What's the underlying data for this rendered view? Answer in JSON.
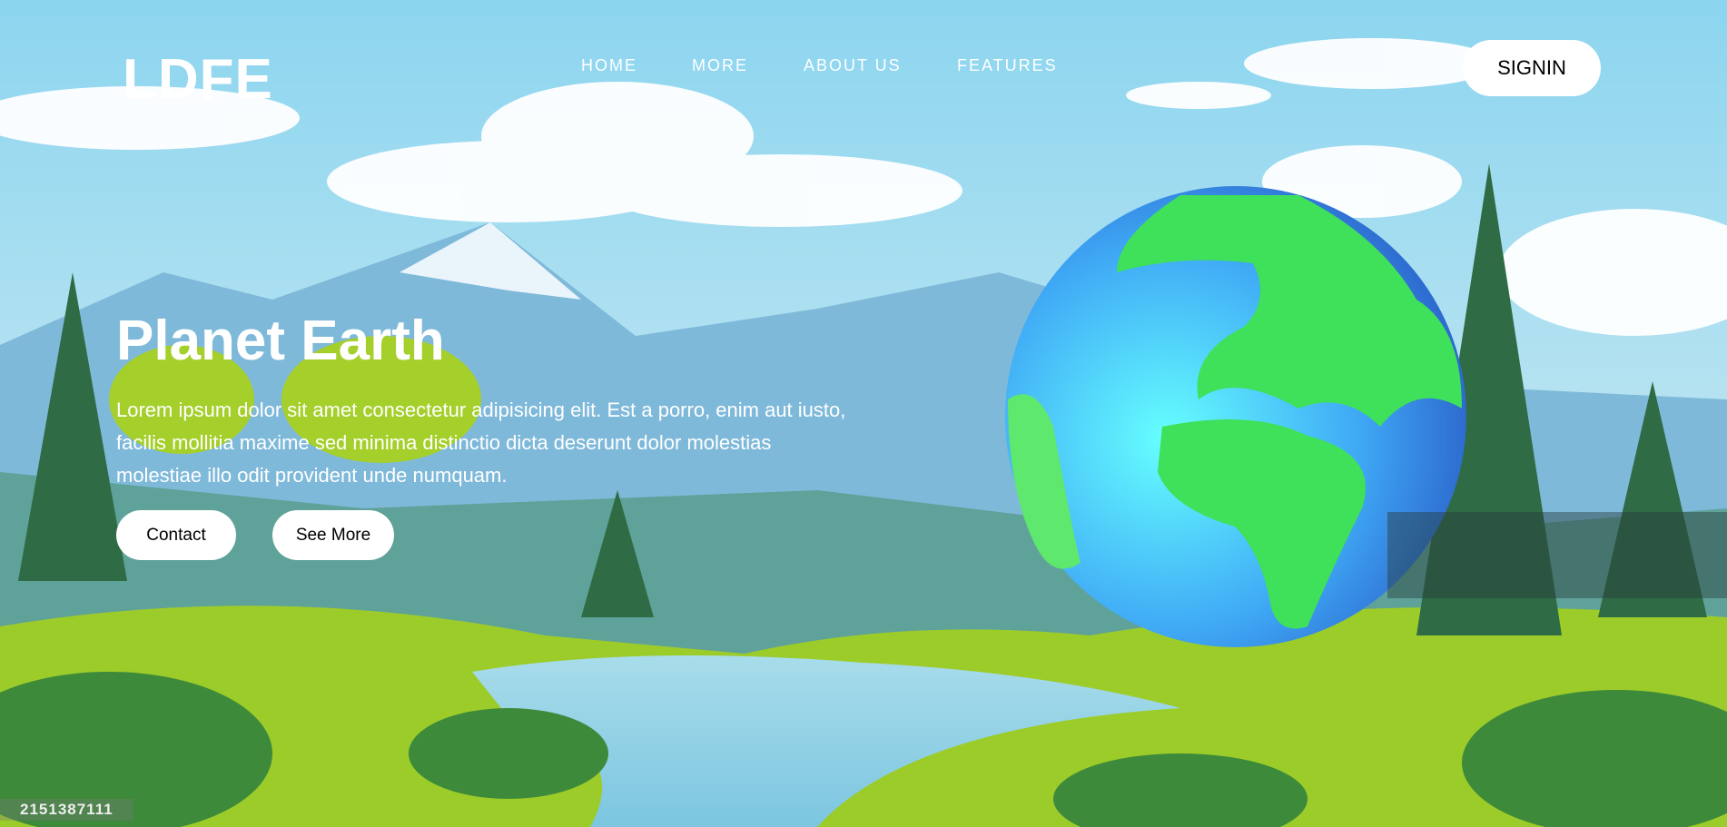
{
  "header": {
    "logo": "LDFE",
    "nav": [
      "HOME",
      "MORE",
      "ABOUT US",
      "FEATURES"
    ],
    "signin_label": "SIGNIN"
  },
  "hero": {
    "title": "Planet Earth",
    "description": "Lorem ipsum dolor sit amet consectetur adipisicing elit. Est a porro, enim aut iusto, facilis mollitia maxime sed minima distinctio dicta deserunt dolor molestias molestiae illo odit provident unde numquam.",
    "contact_label": "Contact",
    "see_more_label": "See More"
  },
  "watermark": "2151387111",
  "colors": {
    "sky": "#8fd6ef",
    "grass": "#9ccc2a",
    "ocean": "#3fa8f0",
    "land": "#3fe05a"
  }
}
